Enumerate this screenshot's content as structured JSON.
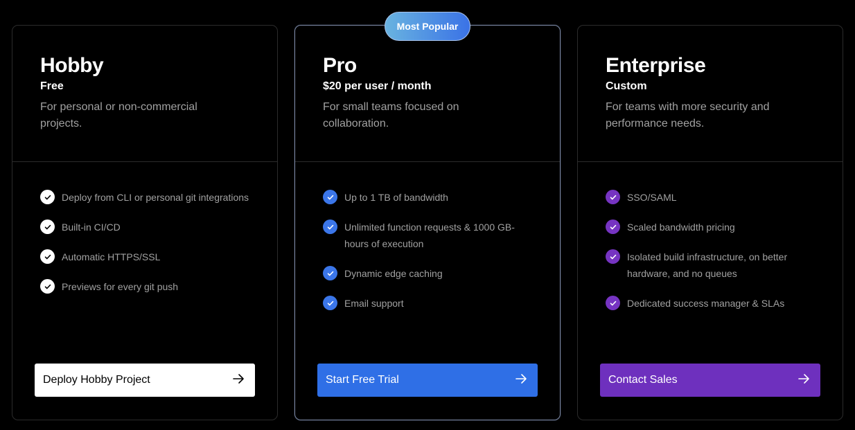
{
  "plans": [
    {
      "title": "Hobby",
      "price": "Free",
      "description": "For personal or non-commercial projects.",
      "check_color": "#ffffff",
      "features": [
        "Deploy from CLI or personal git integrations",
        "Built-in CI/CD",
        "Automatic HTTPS/SSL",
        "Previews for every git push"
      ],
      "cta": "Deploy Hobby Project"
    },
    {
      "badge": "Most Popular",
      "title": "Pro",
      "price": "$20 per user / month",
      "description": "For small teams focused on collaboration.",
      "check_color": "#3b76e9",
      "features": [
        "Up to 1 TB of bandwidth",
        "Unlimited function requests & 1000 GB-hours of execution",
        "Dynamic edge caching",
        "Email support"
      ],
      "cta": "Start Free Trial"
    },
    {
      "title": "Enterprise",
      "price": "Custom",
      "description": "For teams with more security and performance needs.",
      "check_color": "#7634c2",
      "features": [
        "SSO/SAML",
        "Scaled bandwidth pricing",
        "Isolated build infrastructure, on better hardware, and no queues",
        "Dedicated success manager & SLAs"
      ],
      "cta": "Contact Sales"
    }
  ],
  "icons": {
    "check": "check-icon",
    "arrow": "arrow-right-icon"
  }
}
